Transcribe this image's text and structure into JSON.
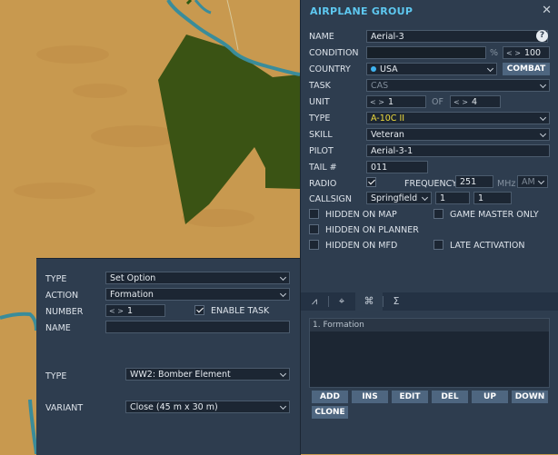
{
  "airplane_group": {
    "title": "AIRPLANE GROUP",
    "close_icon": "close-icon",
    "name_label": "NAME",
    "name_value": "Aerial-3",
    "condition_label": "CONDITION",
    "condition_unit": "%",
    "condition_value": "100",
    "country_label": "COUNTRY",
    "country_value": "USA",
    "combat_label": "COMBAT",
    "task_label": "TASK",
    "task_value": "CAS",
    "unit_label": "UNIT",
    "unit_value": "1",
    "of_label": "OF",
    "unit_total": "4",
    "type_label": "TYPE",
    "type_value": "A-10C II",
    "skill_label": "SKILL",
    "skill_value": "Veteran",
    "pilot_label": "PILOT",
    "pilot_value": "Aerial-3-1",
    "tail_label": "TAIL #",
    "tail_value": "011",
    "radio_label": "RADIO",
    "frequency_label": "FREQUENCY",
    "frequency_value": "251",
    "frequency_unit": "MHz",
    "modulation_value": "AM",
    "callsign_label": "CALLSIGN",
    "callsign_value": "Springfield",
    "callsign_num1": "1",
    "callsign_num2": "1",
    "hidden_on_map_label": "HIDDEN ON MAP",
    "game_master_only_label": "GAME MASTER ONLY",
    "hidden_on_planner_label": "HIDDEN ON PLANNER",
    "hidden_on_mfd_label": "HIDDEN ON MFD",
    "late_activation_label": "LATE ACTIVATION"
  },
  "tabs": [
    {
      "icon": "route-icon",
      "glyph": "⩘"
    },
    {
      "icon": "target-icon",
      "glyph": "⌖"
    },
    {
      "icon": "command-icon",
      "glyph": "⌘"
    },
    {
      "icon": "sigma-icon",
      "glyph": "Σ"
    }
  ],
  "task_list": {
    "items": [
      "1. Formation"
    ]
  },
  "task_buttons": {
    "add": "ADD",
    "ins": "INS",
    "edit": "EDIT",
    "del": "DEL",
    "up": "UP",
    "down": "DOWN",
    "clone": "CLONE"
  },
  "task_panel": {
    "type_label": "TYPE",
    "type_value": "Set Option",
    "action_label": "ACTION",
    "action_value": "Formation",
    "number_label": "NUMBER",
    "number_value": "1",
    "enable_task_label": "ENABLE TASK",
    "name_label": "NAME",
    "name_value": "",
    "formation_type_label": "TYPE",
    "formation_type_value": "WW2: Bomber Element",
    "variant_label": "VARIANT",
    "variant_value": "Close (45 m x 30 m)"
  },
  "colors": {
    "desert": "#c8994f",
    "forest": "#3a5314",
    "river": "#3a8c9a",
    "panel": "#2e3d4f",
    "title_accent": "#5ec8f0",
    "type_yellow": "#f0dc3c"
  }
}
